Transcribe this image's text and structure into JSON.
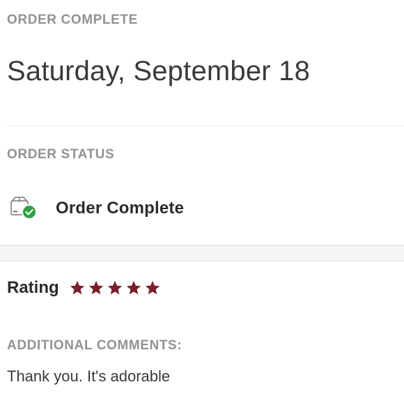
{
  "header": {
    "eyebrow": "ORDER COMPLETE",
    "date": "Saturday, September 18"
  },
  "status": {
    "eyebrow": "ORDER STATUS",
    "label": "Order Complete",
    "icon": "package-check-icon",
    "check_color": "#2f9e44"
  },
  "rating": {
    "label": "Rating",
    "value": 5,
    "max": 5,
    "star_color": "#7a1f2b"
  },
  "comments": {
    "eyebrow": "ADDITIONAL COMMENTS:",
    "text": "Thank you. It's adorable"
  }
}
